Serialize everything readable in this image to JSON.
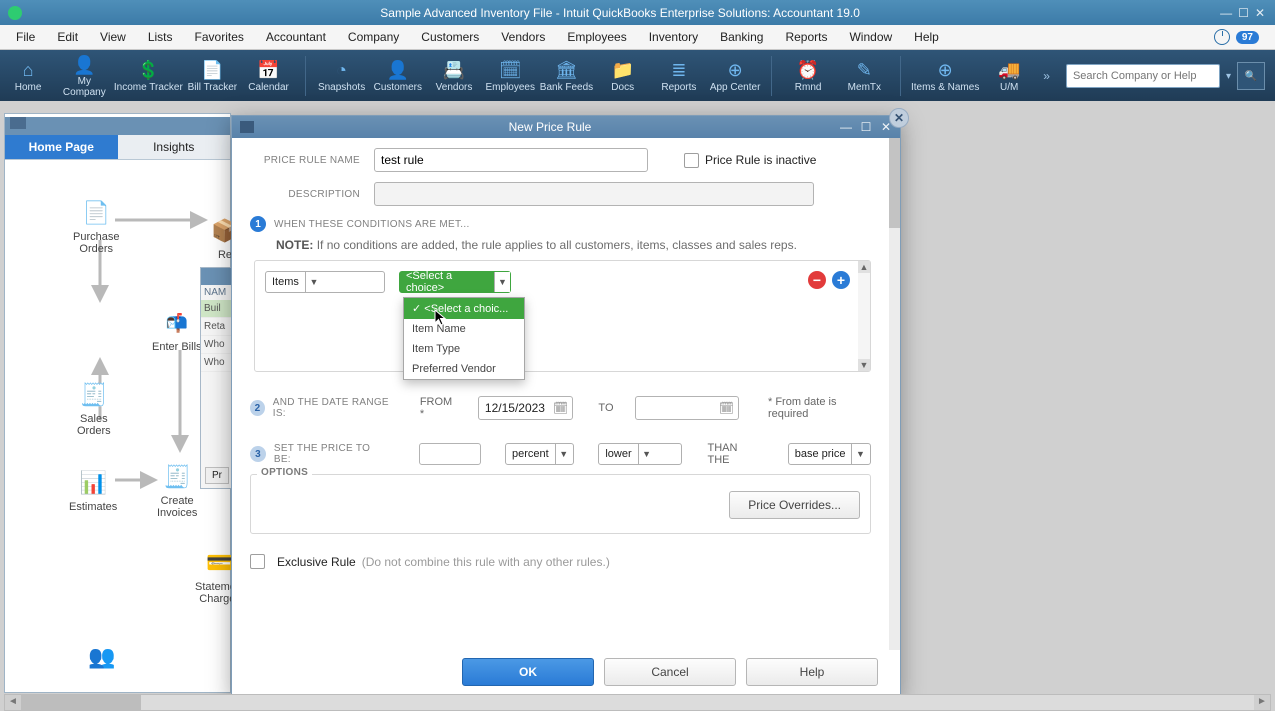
{
  "titlebar": {
    "title": "Sample Advanced Inventory File  -  Intuit QuickBooks Enterprise Solutions: Accountant 19.0"
  },
  "menubar": {
    "items": [
      "File",
      "Edit",
      "View",
      "Lists",
      "Favorites",
      "Accountant",
      "Company",
      "Customers",
      "Vendors",
      "Employees",
      "Inventory",
      "Banking",
      "Reports",
      "Window",
      "Help"
    ],
    "badge": "97"
  },
  "toolbar": {
    "items": [
      {
        "label": "Home",
        "icon": "⌂"
      },
      {
        "label": "My Company",
        "icon": "👤"
      },
      {
        "label": "Income Tracker",
        "icon": "💲"
      },
      {
        "label": "Bill Tracker",
        "icon": "📄"
      },
      {
        "label": "Calendar",
        "icon": "📅"
      }
    ],
    "items2": [
      {
        "label": "Snapshots",
        "icon": "◔"
      },
      {
        "label": "Customers",
        "icon": "👤"
      },
      {
        "label": "Vendors",
        "icon": "📇"
      },
      {
        "label": "Employees",
        "icon": "🗓"
      },
      {
        "label": "Bank Feeds",
        "icon": "🏛"
      },
      {
        "label": "Docs",
        "icon": "📁"
      },
      {
        "label": "Reports",
        "icon": "≣"
      },
      {
        "label": "App Center",
        "icon": "⊕"
      }
    ],
    "items3": [
      {
        "label": "Rmnd",
        "icon": "⏰"
      },
      {
        "label": "MemTx",
        "icon": "✎"
      }
    ],
    "items4": [
      {
        "label": "Items & Names",
        "icon": "⊕"
      },
      {
        "label": "U/M",
        "icon": "🚚"
      }
    ],
    "search_placeholder": "Search Company or Help"
  },
  "home_window": {
    "tabs": [
      "Home Page",
      "Insights"
    ],
    "nodes": {
      "purchase_orders": "Purchase\nOrders",
      "enter_bills": "Enter Bills",
      "sales_orders": "Sales\nOrders",
      "estimates": "Estimates",
      "create_invoices": "Create\nInvoices",
      "statement_charges": "Statement\nCharges",
      "receive": "Re"
    }
  },
  "list_window": {
    "header": "NAM",
    "rows": [
      "Buil",
      "Reta",
      "Who",
      "Who"
    ],
    "btn": "Pr"
  },
  "modal": {
    "title": "New Price Rule",
    "labels": {
      "name": "PRICE RULE NAME",
      "description": "DESCRIPTION",
      "inactive": "Price Rule is inactive",
      "conditions": "WHEN THESE CONDITIONS ARE MET...",
      "note_label": "NOTE:",
      "note_text": "If no conditions are added, the rule applies to all customers, items, classes and sales reps.",
      "date_range": "AND THE DATE RANGE IS:",
      "from": "FROM *",
      "to": "TO",
      "required": "* From date is required",
      "set_price": "SET THE PRICE TO BE:",
      "than": "THAN THE",
      "options": "OPTIONS",
      "price_overrides": "Price Overrides...",
      "exclusive": "Exclusive Rule",
      "exclusive_hint": "(Do not combine this rule with any other rules.)"
    },
    "values": {
      "name": "test rule",
      "conditions_dd1": "Items",
      "conditions_dd2": "<Select a choice>",
      "dd2_options": [
        "<Select a choic...",
        "Item Name",
        "Item Type",
        "Preferred Vendor"
      ],
      "from_date": "12/15/2023",
      "to_date": "",
      "price_amt": "",
      "price_unit": "percent",
      "price_dir": "lower",
      "price_base": "base price"
    },
    "buttons": {
      "ok": "OK",
      "cancel": "Cancel",
      "help": "Help"
    }
  }
}
